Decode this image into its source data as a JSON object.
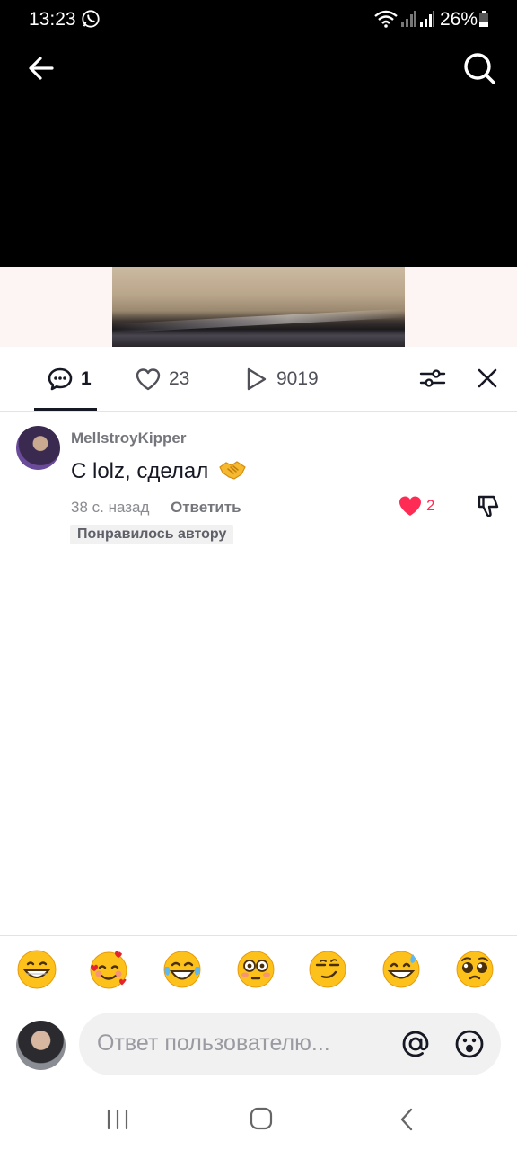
{
  "status_bar": {
    "time": "13:23",
    "battery": "26%"
  },
  "header": {
    "back_icon": "arrow-left-icon",
    "search_icon": "search-icon"
  },
  "tabs": {
    "comments_count": "1",
    "likes_count": "23",
    "views_count": "9019"
  },
  "comment": {
    "username": "MellstroyKipper",
    "text": "С lolz, сделал",
    "emoji": "handshake-emoji",
    "time": "38 с. назад",
    "reply_label": "Ответить",
    "liked_by_author": "Понравилось автору",
    "like_count": "2"
  },
  "composer": {
    "placeholder": "Ответ пользователю...",
    "quick_emojis": [
      "grinning-face",
      "smiling-face-with-hearts",
      "tears-of-joy",
      "flushed-face",
      "smirking-face",
      "grinning-sweat",
      "pleading-face"
    ]
  },
  "colors": {
    "accent_red": "#fe2c55",
    "text_primary": "#161823",
    "text_secondary": "#75767c"
  }
}
